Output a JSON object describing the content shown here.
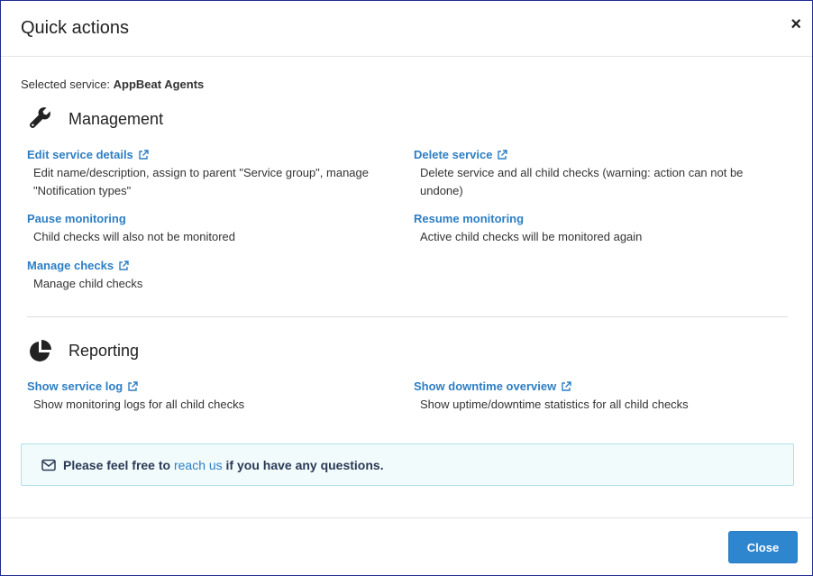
{
  "dialog": {
    "title": "Quick actions",
    "close_symbol": "×",
    "selected_label": "Selected service:",
    "selected_value": "AppBeat Agents"
  },
  "management": {
    "title": "Management",
    "icon": "wrench-icon",
    "items": [
      {
        "label": "Edit service details",
        "desc": "Edit name/description, assign to parent \"Service group\", manage \"Notification types\""
      },
      {
        "label": "Delete service",
        "desc": "Delete service and all child checks (warning: action can not be undone)"
      },
      {
        "label": "Pause monitoring",
        "desc": "Child checks will also not be monitored"
      },
      {
        "label": "Resume monitoring",
        "desc": "Active child checks will be monitored again"
      },
      {
        "label": "Manage checks",
        "desc": "Manage child checks"
      }
    ]
  },
  "reporting": {
    "title": "Reporting",
    "icon": "pie-chart-icon",
    "items": [
      {
        "label": "Show service log",
        "desc": "Show monitoring logs for all child checks"
      },
      {
        "label": "Show downtime overview",
        "desc": "Show uptime/downtime statistics for all child checks"
      }
    ]
  },
  "notice": {
    "prefix": "Please feel free to",
    "link": "reach us",
    "suffix": "if you have any questions."
  },
  "footer": {
    "close_label": "Close"
  },
  "colors": {
    "link": "#2d7ec4",
    "primary_button": "#2e86cf",
    "notice_bg": "#f2fbfc",
    "notice_border": "#aee0e8"
  }
}
